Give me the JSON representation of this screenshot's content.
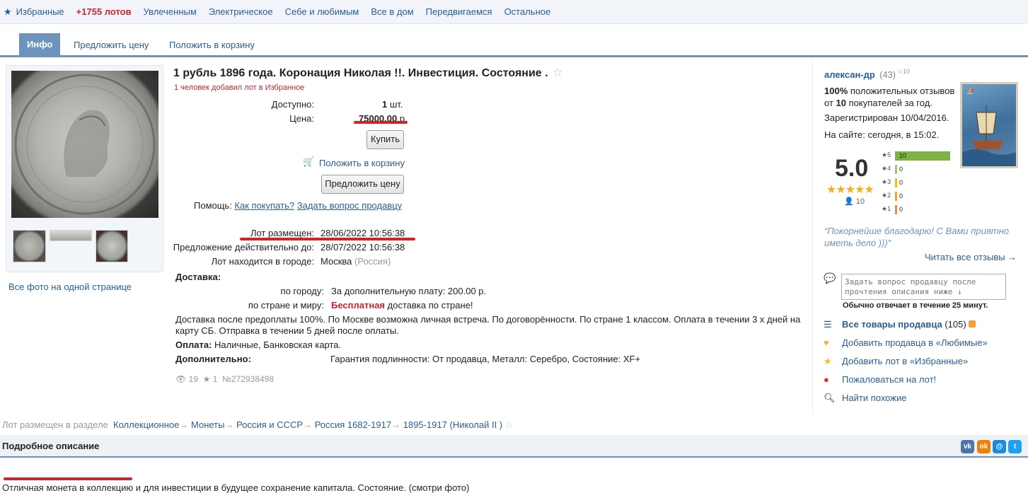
{
  "topnav": {
    "items": [
      "Избранные",
      "+1755 лотов",
      "Увлеченным",
      "Электрическое",
      "Себе и любимым",
      "Все в дом",
      "Передвигаемся",
      "Остальное"
    ]
  },
  "tabs": [
    "Инфо",
    "Предложить цену",
    "Положить в корзину"
  ],
  "gallery": {
    "all_photos": "Все фото на одной странице"
  },
  "lot": {
    "title": "1 рубль 1896 года. Коронация Николая !!. Инвестиция. Состояние .",
    "fav_note": "1 человек добавил лот в Избранное",
    "available_label": "Доступно:",
    "available_qty": "1",
    "available_unit": "шт.",
    "price_label": "Цена:",
    "price_value": "75000.00",
    "price_currency": "р.",
    "buy_button": "Купить",
    "cart_link": "Положить в корзину",
    "offer_button": "Предложить цену",
    "help_label": "Помощь:",
    "help_how": "Как покупать?",
    "help_ask": "Задать вопрос продавцу",
    "placed_label": "Лот размещен:",
    "placed_value": "28/06/2022 10:56:38",
    "valid_label": "Предложение действительно до:",
    "valid_value": "28/07/2022 10:56:38",
    "city_label": "Лот находится в городе:",
    "city_value": "Москва",
    "city_country": "(Россия)",
    "delivery_label": "Доставка:",
    "by_city_label": "по городу:",
    "by_city_value": "За дополнительную плату: 200.00 р.",
    "by_country_label": "по стране и миру:",
    "by_country_free": "Бесплатная",
    "by_country_rest": "доставка по стране!",
    "delivery_note_1": "Доставка после предоплаты 100%. По Москве возможна личная встреча. По договорённости. По стране 1 классом. Оплата в течении 3 х дней на",
    "delivery_note_2": "карту СБ. Отправка в течении 5 дней после оплаты.",
    "payment_label": "Оплата:",
    "payment_value": "Наличные, Банковская карта.",
    "extra_label": "Дополнительно:",
    "extra_value": "Гарантия подлинности: От продавца, Металл: Серебро, Состояние: XF+",
    "views": "19",
    "favs": "1",
    "lot_number": "№272938498"
  },
  "seller": {
    "name": "алексан-др",
    "rating_count": "(43)",
    "badge": "10",
    "pos_pct": "100%",
    "pos_text": "положительных отзывов",
    "from_text": "от",
    "buyers_count": "10",
    "buyers_text": "покупателей за год.",
    "registered": "Зарегистрирован 10/04/2016.",
    "online": "На сайте: сегодня, в 15:02.",
    "score": "5.0",
    "reviewers": "10",
    "histogram": [
      {
        "star": "5",
        "count": "10",
        "value": 10
      },
      {
        "star": "4",
        "count": "0",
        "value": 0
      },
      {
        "star": "3",
        "count": "0",
        "value": 0
      },
      {
        "star": "2",
        "count": "0",
        "value": 0
      },
      {
        "star": "1",
        "count": "0",
        "value": 0
      }
    ],
    "quote": "“Покорнейше благодарю! С Вами приятно иметь дело )))”",
    "read_all": "Читать все отзывы →",
    "ask_placeholder": "Задать вопрос продавцу после прочтения описания ниже ↓",
    "response_time": "Обычно отвечает в течение 25 минут.",
    "all_items": "Все товары продавца",
    "all_items_count": "(105)",
    "add_fav_seller": "Добавить продавца в «Любимые»",
    "add_fav_lot": "Добавить лот в «Избранные»",
    "complain": "Пожаловаться на лот!",
    "find_similar": "Найти похожие"
  },
  "crumbs": {
    "label": "Лот размещен в разделе",
    "items": [
      "Коллекционное",
      "Монеты",
      "Россия и СССР",
      "Россия 1682-1917",
      "1895-1917 (Николай II )"
    ]
  },
  "description": {
    "title": "Подробное описание",
    "text": "Отличная монета в коллекцию и для инвестиции в будущее сохранение капитала. Состояние. (смотри фото)"
  },
  "colors": {
    "accent": "#6d93bd",
    "link": "#2a5d96",
    "highlight": "#d0232a",
    "star": "#f2b01e"
  }
}
